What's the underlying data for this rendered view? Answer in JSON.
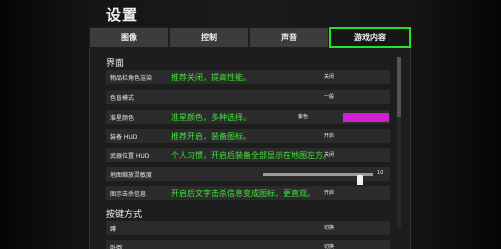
{
  "page": {
    "title": "设置"
  },
  "tabs": [
    {
      "label": "图像",
      "active": false
    },
    {
      "label": "控制",
      "active": false
    },
    {
      "label": "声音",
      "active": false
    },
    {
      "label": "游戏内容",
      "active": true
    }
  ],
  "sections": {
    "interface": "界面",
    "keybinds": "按键方式"
  },
  "rows": [
    {
      "label": "物品栏角色渲染",
      "hint": "推荐关闭，提高性能。",
      "value": "关闭"
    },
    {
      "label": "色盲模式",
      "hint": "",
      "value": "一般"
    },
    {
      "label": "准星颜色",
      "hint": "准星颜色，多种选择。",
      "value": "紫色",
      "swatch_color": "#d01fd0"
    },
    {
      "label": "装备 HUD",
      "hint": "推荐开启，装备图标。",
      "value": "开启"
    },
    {
      "label": "武器位置 HUD",
      "hint": "个人习惯，开启后装备全部显示在地图左方。",
      "value": "关闭"
    },
    {
      "label": "地图缩放灵敏度",
      "hint": "",
      "value": "10",
      "slider_fraction": 0.9
    },
    {
      "label": "图示击杀信息",
      "hint": "开启后文字击杀信息变成图标，更直观。",
      "value": "开启"
    }
  ],
  "keybind_rows": [
    {
      "label": "蹲",
      "value": "切换"
    },
    {
      "label": "卧倒",
      "value": "切换"
    }
  ],
  "colors": {
    "accent_green": "#27e02a",
    "hint_green": "#41e63a",
    "crosshair_purple": "#d01fd0"
  }
}
